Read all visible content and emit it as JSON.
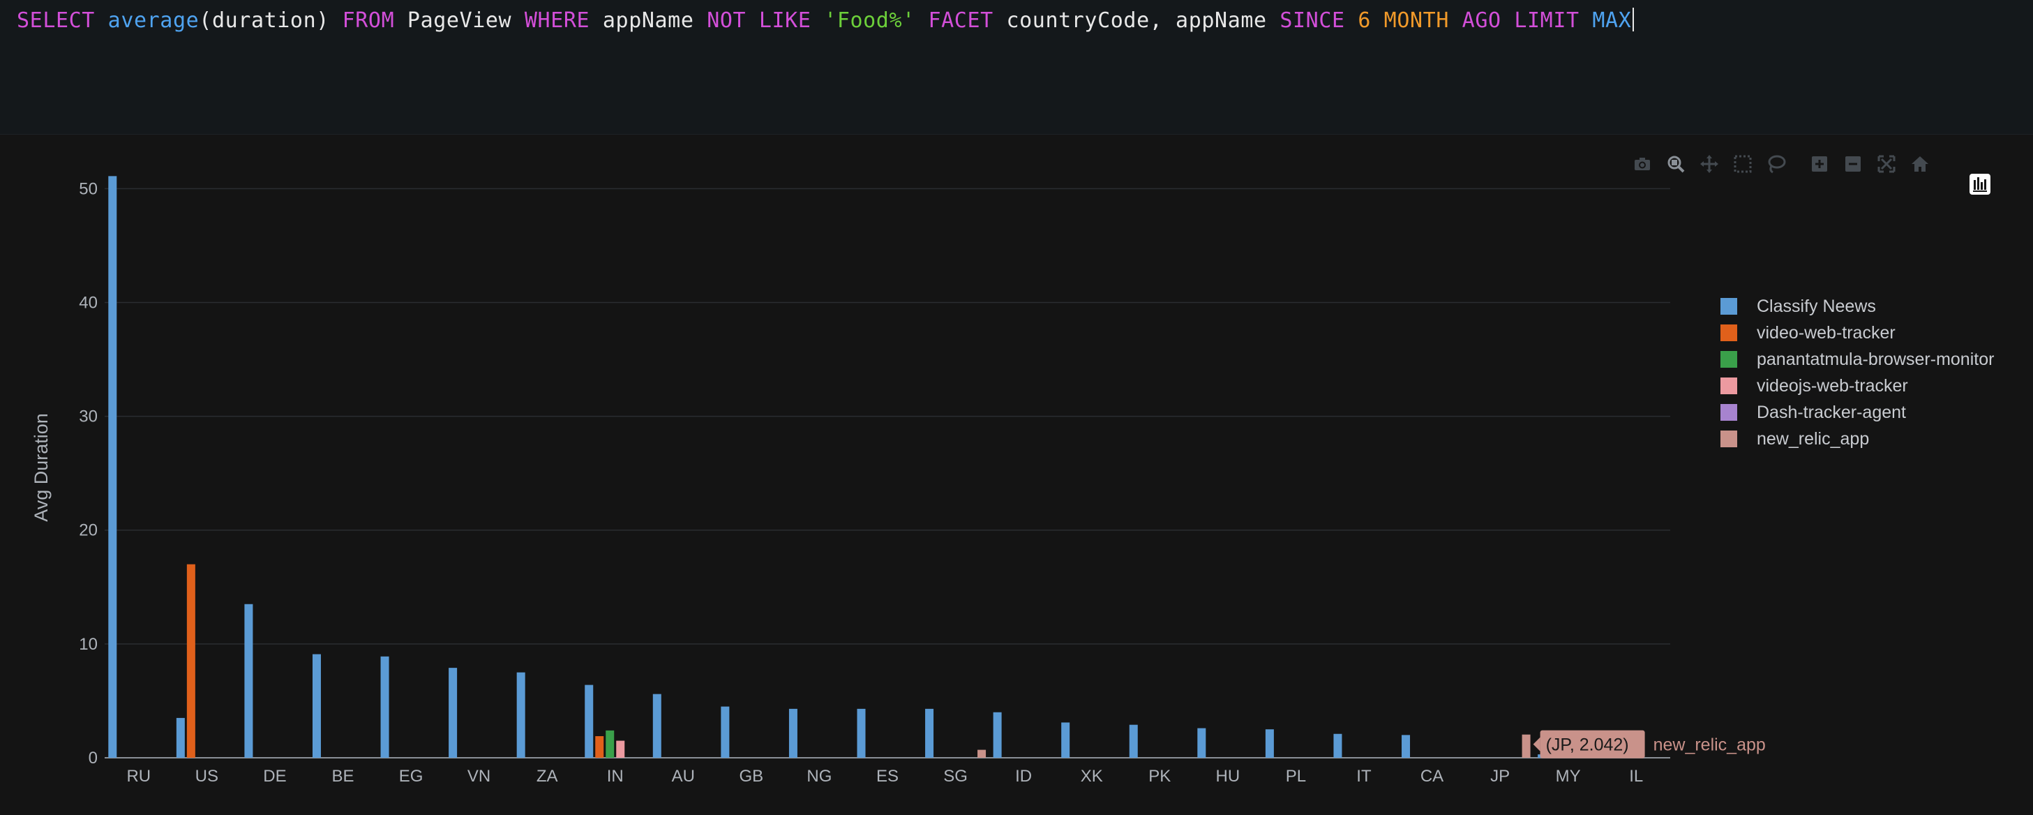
{
  "query": {
    "tokens": [
      {
        "t": "SELECT",
        "c": "kw"
      },
      {
        "t": " ",
        "c": "pun"
      },
      {
        "t": "average",
        "c": "fn"
      },
      {
        "t": "(duration)",
        "c": "pun"
      },
      {
        "t": " ",
        "c": "pun"
      },
      {
        "t": "FROM",
        "c": "kw"
      },
      {
        "t": " ",
        "c": "pun"
      },
      {
        "t": "PageView",
        "c": "id"
      },
      {
        "t": " ",
        "c": "pun"
      },
      {
        "t": "WHERE",
        "c": "kw"
      },
      {
        "t": " ",
        "c": "pun"
      },
      {
        "t": "appName",
        "c": "id"
      },
      {
        "t": " ",
        "c": "pun"
      },
      {
        "t": "NOT LIKE",
        "c": "kw"
      },
      {
        "t": " ",
        "c": "pun"
      },
      {
        "t": "'Food%'",
        "c": "str"
      },
      {
        "t": " ",
        "c": "pun"
      },
      {
        "t": "FACET",
        "c": "kw"
      },
      {
        "t": " ",
        "c": "pun"
      },
      {
        "t": "countryCode, appName",
        "c": "id"
      },
      {
        "t": " ",
        "c": "pun"
      },
      {
        "t": "SINCE",
        "c": "kw"
      },
      {
        "t": " ",
        "c": "pun"
      },
      {
        "t": "6 MONTH",
        "c": "num"
      },
      {
        "t": " ",
        "c": "pun"
      },
      {
        "t": "AGO",
        "c": "kw"
      },
      {
        "t": " ",
        "c": "pun"
      },
      {
        "t": "LIMIT",
        "c": "kw"
      },
      {
        "t": " ",
        "c": "pun"
      },
      {
        "t": "MAX",
        "c": "fn"
      }
    ]
  },
  "modebar": {
    "icons": [
      "camera-icon",
      "zoom-icon",
      "pan-icon",
      "box-select-icon",
      "lasso-select-icon",
      "zoom-in-icon",
      "zoom-out-icon",
      "autoscale-icon",
      "reset-axes-icon"
    ]
  },
  "colors": {
    "Classify Neews": "#5b9bd5",
    "video-web-tracker": "#e0601b",
    "panantatmula-browser-monitor": "#3aa04a",
    "videojs-web-tracker": "#ec9aa0",
    "Dash-tracker-agent": "#a783cf",
    "new_relic_app": "#c9928a"
  },
  "chart_data": {
    "type": "bar",
    "ylabel": "Avg Duration",
    "xlabel": "",
    "ylim": [
      0,
      51
    ],
    "yticks": [
      0,
      10,
      20,
      30,
      40,
      50
    ],
    "grid": true,
    "legend_position": "right",
    "categories": [
      "RU",
      "US",
      "DE",
      "BE",
      "EG",
      "VN",
      "ZA",
      "IN",
      "AU",
      "GB",
      "NG",
      "ES",
      "SG",
      "ID",
      "XK",
      "PK",
      "HU",
      "PL",
      "IT",
      "CA",
      "JP",
      "MY",
      "IL"
    ],
    "series": [
      {
        "name": "Classify Neews",
        "values": [
          51.1,
          3.5,
          13.5,
          9.1,
          8.9,
          7.9,
          7.5,
          6.4,
          5.6,
          4.5,
          4.3,
          4.3,
          4.3,
          4.0,
          3.1,
          2.9,
          2.6,
          2.5,
          2.1,
          2.0,
          null,
          0.3,
          0.3
        ]
      },
      {
        "name": "video-web-tracker",
        "values": [
          null,
          17.0,
          null,
          null,
          null,
          null,
          null,
          1.9,
          null,
          null,
          null,
          null,
          null,
          null,
          null,
          null,
          null,
          null,
          null,
          null,
          null,
          null,
          null
        ]
      },
      {
        "name": "panantatmula-browser-monitor",
        "values": [
          null,
          null,
          null,
          null,
          null,
          null,
          null,
          2.4,
          null,
          null,
          null,
          null,
          null,
          null,
          null,
          null,
          null,
          null,
          null,
          null,
          null,
          null,
          null
        ]
      },
      {
        "name": "videojs-web-tracker",
        "values": [
          null,
          null,
          null,
          null,
          null,
          null,
          null,
          1.5,
          null,
          null,
          null,
          null,
          null,
          null,
          null,
          null,
          null,
          null,
          null,
          null,
          null,
          null,
          null
        ]
      },
      {
        "name": "Dash-tracker-agent",
        "values": [
          null,
          null,
          null,
          null,
          null,
          null,
          null,
          null,
          null,
          null,
          null,
          null,
          null,
          null,
          null,
          null,
          null,
          null,
          null,
          null,
          null,
          null,
          null
        ]
      },
      {
        "name": "new_relic_app",
        "values": [
          null,
          null,
          null,
          null,
          null,
          null,
          null,
          null,
          null,
          null,
          null,
          null,
          0.7,
          null,
          null,
          null,
          null,
          null,
          null,
          null,
          2.042,
          null,
          null
        ]
      }
    ],
    "hover": {
      "text": "(JP, 2.042)",
      "series": "new_relic_app"
    }
  }
}
